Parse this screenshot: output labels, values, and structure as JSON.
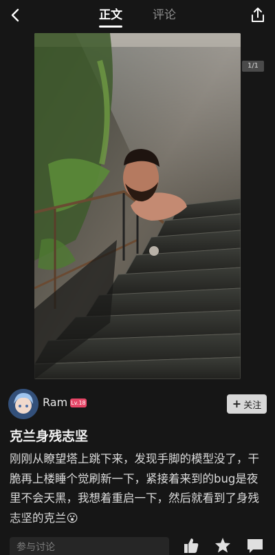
{
  "header": {
    "tabs": [
      {
        "label": "正文",
        "active": true
      },
      {
        "label": "评论",
        "active": false
      }
    ]
  },
  "image": {
    "counter": "1/1"
  },
  "author": {
    "name": "Ram",
    "level": "Lv.18",
    "follow_label": "关注"
  },
  "post": {
    "title": "克兰身残志坚",
    "body": "刚刚从瞭望塔上跳下来，发现手脚的模型没了，干脆再上楼睡个觉刷新一下，紧接着来到的bug是夜里不会天黑，我想着重启一下，然后就看到了身残志坚的克兰😮"
  },
  "bottom": {
    "comment_placeholder": "参与讨论"
  },
  "icons": {
    "back": "chevron-left-icon",
    "share": "share-icon",
    "plus": "plus-icon",
    "like": "thumbs-up-icon",
    "favorite": "star-icon",
    "comment": "comment-icon"
  },
  "colors": {
    "background": "#161616",
    "level_badge": "#e64566",
    "follow_button": "#d8d8d8"
  }
}
